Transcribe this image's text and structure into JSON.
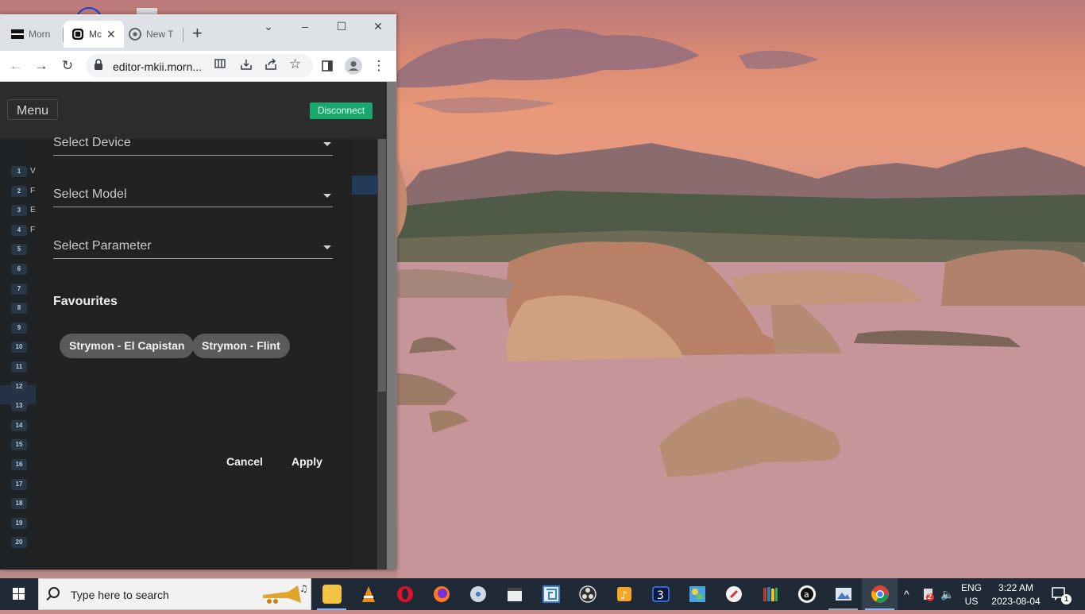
{
  "browser": {
    "tabs": [
      {
        "label": "Morn"
      },
      {
        "label": "Mc"
      },
      {
        "label": "New T"
      }
    ],
    "url": "editor-mkii.morn..."
  },
  "app": {
    "menu_label": "Menu",
    "disconnect_label": "Disconnect",
    "rows": [
      "1",
      "2",
      "3",
      "4",
      "5",
      "6",
      "7",
      "8",
      "9",
      "10",
      "11",
      "12",
      "13",
      "14",
      "15",
      "16",
      "17",
      "18",
      "19",
      "20"
    ],
    "row_letters": [
      "V",
      "F",
      "E",
      "F"
    ],
    "dialog": {
      "select_device": "Select Device",
      "select_model": "Select Model",
      "select_parameter": "Select Parameter",
      "favourites_heading": "Favourites",
      "favourites": [
        "Strymon - El Capistan",
        "Strymon - Flint"
      ],
      "cancel_label": "Cancel",
      "apply_label": "Apply"
    }
  },
  "taskbar": {
    "search_placeholder": "Type here to search",
    "lang_top": "ENG",
    "lang_bottom": "US",
    "time": "3:22 AM",
    "date": "2023-08-04",
    "notification_count": "1",
    "tray_badge": "2"
  }
}
